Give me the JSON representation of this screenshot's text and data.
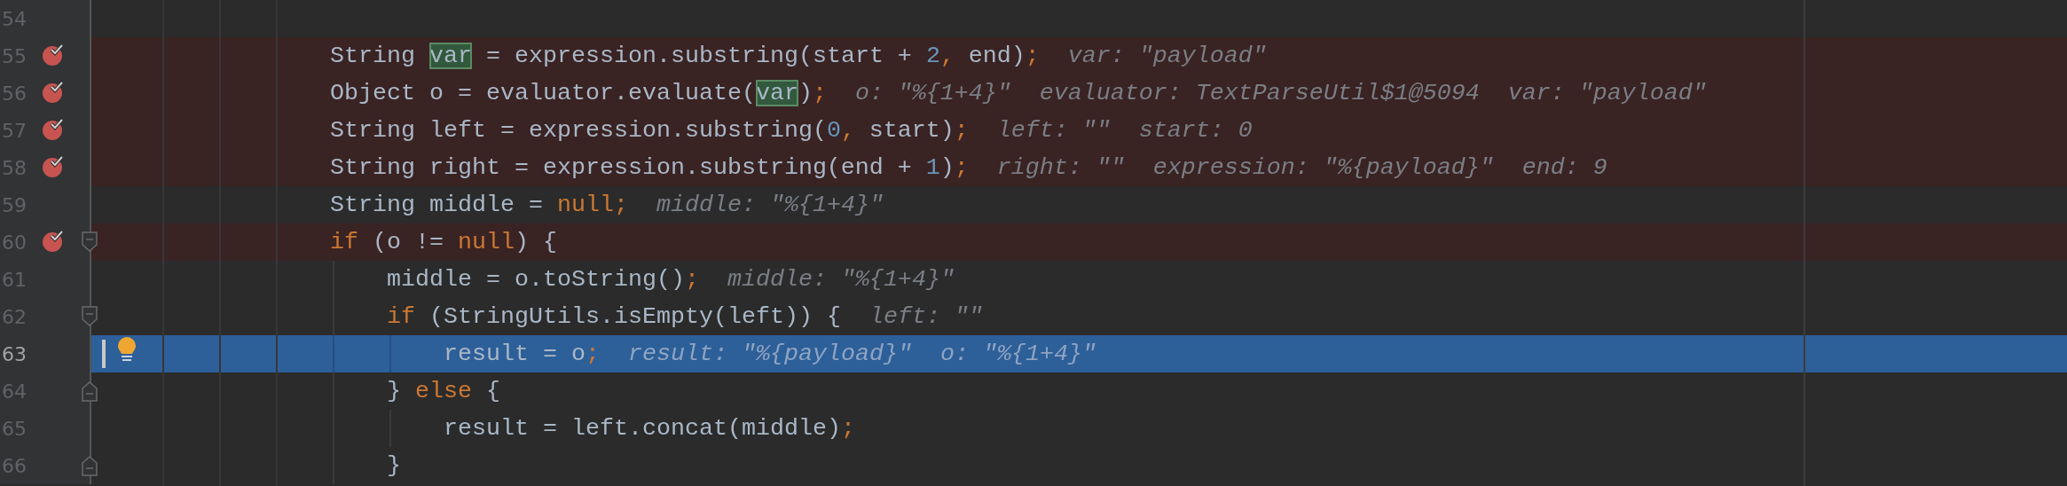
{
  "editor": {
    "lines": [
      {
        "number": "54",
        "breakpoint": false,
        "current": false
      },
      {
        "number": "55",
        "breakpoint": true,
        "current": false,
        "tokens": [
          {
            "text": "String ",
            "kind": "plain"
          },
          {
            "text": "var",
            "kind": "usage"
          },
          {
            "text": " = expression.substring(start + ",
            "kind": "plain"
          },
          {
            "text": "2",
            "kind": "number"
          },
          {
            "text": ",",
            "kind": "punct"
          },
          {
            "text": " end)",
            "kind": "plain"
          },
          {
            "text": ";",
            "kind": "punct"
          }
        ],
        "hints": [
          "var: \"payload\""
        ]
      },
      {
        "number": "56",
        "breakpoint": true,
        "current": false,
        "tokens": [
          {
            "text": "Object o = evaluator.evaluate(",
            "kind": "plain"
          },
          {
            "text": "var",
            "kind": "usage"
          },
          {
            "text": ")",
            "kind": "plain"
          },
          {
            "text": ";",
            "kind": "punct"
          }
        ],
        "hints": [
          "o: \"%{1+4}\"",
          "evaluator: TextParseUtil$1@5094",
          "var: \"payload\""
        ]
      },
      {
        "number": "57",
        "breakpoint": true,
        "current": false,
        "tokens": [
          {
            "text": "String left = expression.substring(",
            "kind": "plain"
          },
          {
            "text": "0",
            "kind": "number"
          },
          {
            "text": ",",
            "kind": "punct"
          },
          {
            "text": " start)",
            "kind": "plain"
          },
          {
            "text": ";",
            "kind": "punct"
          }
        ],
        "hints": [
          "left: \"\"",
          "start: 0"
        ]
      },
      {
        "number": "58",
        "breakpoint": true,
        "current": false,
        "tokens": [
          {
            "text": "String right = expression.substring(end + ",
            "kind": "plain"
          },
          {
            "text": "1",
            "kind": "number"
          },
          {
            "text": ")",
            "kind": "plain"
          },
          {
            "text": ";",
            "kind": "punct"
          }
        ],
        "hints": [
          "right: \"\"",
          "expression: \"%{payload}\"",
          "end: 9"
        ]
      },
      {
        "number": "59",
        "breakpoint": false,
        "current": false,
        "tokens": [
          {
            "text": "String middle = ",
            "kind": "plain"
          },
          {
            "text": "null",
            "kind": "keyword"
          },
          {
            "text": ";",
            "kind": "punct"
          }
        ],
        "hints": [
          "middle: \"%{1+4}\""
        ]
      },
      {
        "number": "60",
        "breakpoint": true,
        "current": false,
        "fold_start": true,
        "tokens": [
          {
            "text": "if",
            "kind": "keyword"
          },
          {
            "text": " (o != ",
            "kind": "plain"
          },
          {
            "text": "null",
            "kind": "keyword"
          },
          {
            "text": ") {",
            "kind": "plain"
          }
        ],
        "children": [
          {
            "number": "61",
            "breakpoint": false,
            "current": false,
            "tokens": [
              {
                "text": "middle = o.toString()",
                "kind": "plain"
              },
              {
                "text": ";",
                "kind": "punct"
              }
            ],
            "hints": [
              "middle: \"%{1+4}\""
            ]
          },
          {
            "number": "62",
            "breakpoint": false,
            "current": false,
            "fold_start": true,
            "tokens": [
              {
                "text": "if",
                "kind": "keyword"
              },
              {
                "text": " (StringUtils.isEmpty(left)) {",
                "kind": "plain"
              }
            ],
            "hints": [
              "left: \"\""
            ],
            "children": [
              {
                "number": "63",
                "breakpoint": false,
                "current": true,
                "intention_bulb": true,
                "tokens": [
                  {
                    "text": "result = o",
                    "kind": "plain"
                  },
                  {
                    "text": ";",
                    "kind": "punct"
                  }
                ],
                "hints": [
                  "result: \"%{payload}\"",
                  "o: \"%{1+4}\""
                ]
              }
            ]
          },
          {
            "number": "64",
            "breakpoint": false,
            "current": false,
            "fold_end": true,
            "tokens": [
              {
                "text": "} ",
                "kind": "plain"
              },
              {
                "text": "else",
                "kind": "keyword"
              },
              {
                "text": " {",
                "kind": "plain"
              }
            ],
            "children": [
              {
                "number": "65",
                "breakpoint": false,
                "current": false,
                "tokens": [
                  {
                    "text": "result = left.concat(middle)",
                    "kind": "plain"
                  },
                  {
                    "text": ";",
                    "kind": "punct"
                  }
                ]
              }
            ]
          },
          {
            "number": "66",
            "breakpoint": false,
            "current": false,
            "fold_end": true,
            "tokens": [
              {
                "text": "}",
                "kind": "plain"
              }
            ]
          }
        ]
      }
    ]
  }
}
